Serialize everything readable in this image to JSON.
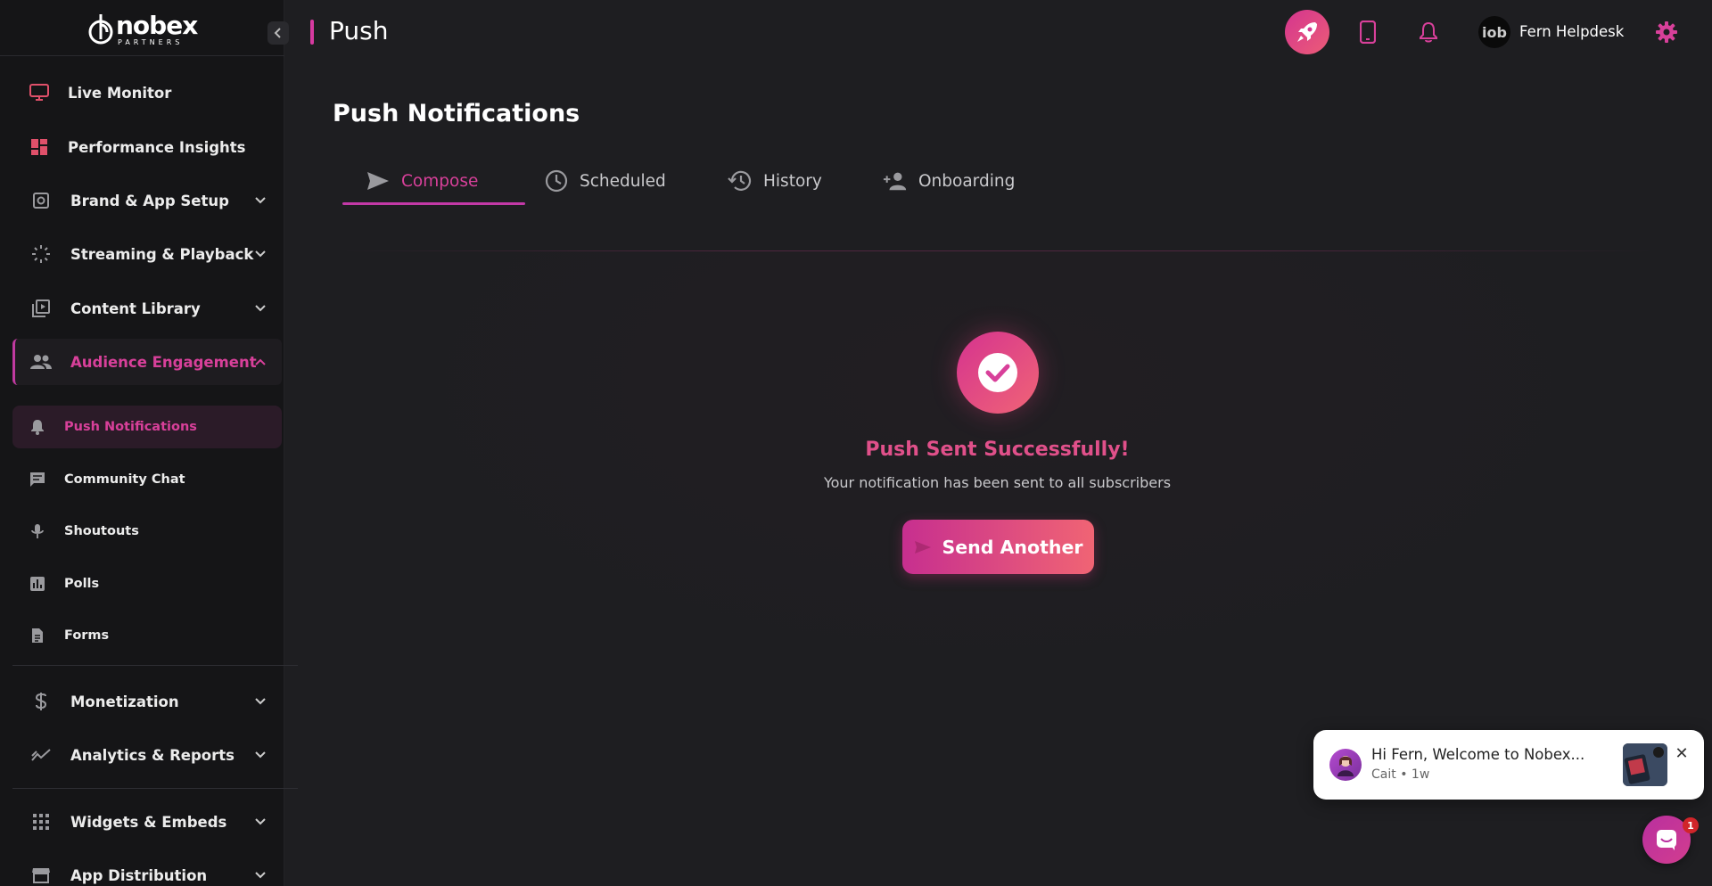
{
  "brand": {
    "name": "nobex",
    "tagline": "PARTNERS"
  },
  "header": {
    "title": "Push",
    "user_name": "Fern Helpdesk",
    "avatar_text": "iob"
  },
  "sidebar": {
    "items": [
      {
        "label": "Live Monitor",
        "icon": "monitor-icon"
      },
      {
        "label": "Performance Insights",
        "icon": "dashboard-icon"
      },
      {
        "label": "Brand & App Setup",
        "icon": "app-setup-icon"
      },
      {
        "label": "Streaming & Playback",
        "icon": "streaming-icon"
      },
      {
        "label": "Content Library",
        "icon": "library-icon"
      },
      {
        "label": "Audience Engagement",
        "icon": "people-icon"
      },
      {
        "label": "Monetization",
        "icon": "dollar-icon"
      },
      {
        "label": "Analytics & Reports",
        "icon": "analytics-icon"
      },
      {
        "label": "Widgets & Embeds",
        "icon": "grid-icon"
      },
      {
        "label": "App Distribution",
        "icon": "store-icon"
      }
    ],
    "sub_items": [
      {
        "label": "Push Notifications",
        "icon": "bell-icon"
      },
      {
        "label": "Community Chat",
        "icon": "chat-icon"
      },
      {
        "label": "Shoutouts",
        "icon": "microphone-icon"
      },
      {
        "label": "Polls",
        "icon": "poll-icon"
      },
      {
        "label": "Forms",
        "icon": "form-icon"
      }
    ]
  },
  "page": {
    "title": "Push Notifications",
    "tabs": [
      {
        "label": "Compose",
        "icon": "send-icon"
      },
      {
        "label": "Scheduled",
        "icon": "clock-icon"
      },
      {
        "label": "History",
        "icon": "history-icon"
      },
      {
        "label": "Onboarding",
        "icon": "person-add-icon"
      }
    ],
    "success": {
      "title": "Push Sent Successfully!",
      "subtitle": "Your notification has been sent to all subscribers",
      "button_label": "Send Another"
    }
  },
  "chat": {
    "message": "Hi Fern, Welcome to Nobex...",
    "author": "Cait",
    "time": "1w",
    "badge_count": "1"
  },
  "colors": {
    "accent": "#d8409a",
    "gradient_start": "#d4358f",
    "gradient_end": "#f06476",
    "background": "#1e1e21",
    "sidebar": "#151517"
  }
}
